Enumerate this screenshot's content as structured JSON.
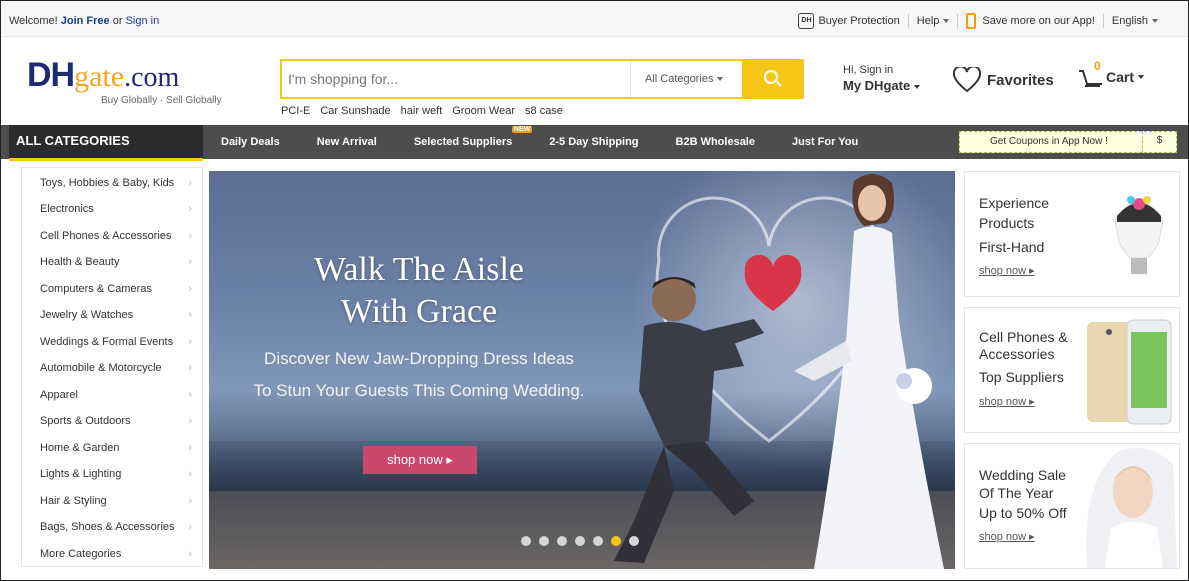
{
  "topbar": {
    "welcome": "Welcome!",
    "join": "Join Free",
    "or": "or",
    "signin": "Sign in",
    "buyer_protection": "Buyer Protection",
    "help": "Help",
    "app": "Save more on our App!",
    "language": "English"
  },
  "logo": {
    "dh": "DH",
    "gate": "gate",
    "com": ".com",
    "tagline": "Buy Globally · Sell Globally"
  },
  "search": {
    "placeholder": "I'm shopping for...",
    "category": "All Categories",
    "hot_terms": [
      "PCI-E",
      "Car Sunshade",
      "hair weft",
      "Groom Wear",
      "s8 case"
    ]
  },
  "account": {
    "greeting": "Hi, Sign in",
    "label": "My DHgate"
  },
  "favorites": "Favorites",
  "cart": {
    "label": "Cart",
    "count": "0"
  },
  "nav": {
    "all_categories": "ALL CATEGORIES",
    "links": [
      "Daily Deals",
      "New Arrival",
      "Selected Suppliers",
      "2-5 Day Shipping",
      "B2B Wholesale",
      "Just For You"
    ],
    "new_badge": "NEW",
    "coupon": "Get Coupons in App Now !",
    "coupon_symbol": "$"
  },
  "categories": [
    "Toys, Hobbies & Baby, Kids",
    "Electronics",
    "Cell Phones & Accessories",
    "Health & Beauty",
    "Computers & Cameras",
    "Jewelry & Watches",
    "Weddings & Formal Events",
    "Automobile & Motorcycle",
    "Apparel",
    "Sports & Outdoors",
    "Home & Garden",
    "Lights & Lighting",
    "Hair & Styling",
    "Bags, Shoes & Accessories",
    "More Categories"
  ],
  "banner": {
    "headline_1": "Walk The Aisle",
    "headline_2": "With Grace",
    "sub_1": "Discover New Jaw-Dropping Dress Ideas",
    "sub_2": "To Stun Your Guests This Coming Wedding.",
    "cta": "shop now ▸",
    "slides": 7,
    "active_slide": 6
  },
  "promos": [
    {
      "lines": [
        "Experience",
        "Products",
        "First-Hand"
      ],
      "link": "shop now ▸"
    },
    {
      "lines": [
        "Cell Phones &",
        "Accessories",
        "Top Suppliers"
      ],
      "link": "shop now ▸"
    },
    {
      "lines": [
        "Wedding Sale",
        "Of The Year",
        "Up to 50% Off"
      ],
      "link": "shop now ▸"
    }
  ],
  "colors": {
    "accent": "#f5c518",
    "brand_navy": "#1e2b6e",
    "brand_orange": "#f5a623",
    "cta_pink": "#c8496b",
    "nav_dark": "#4d4d4d"
  }
}
